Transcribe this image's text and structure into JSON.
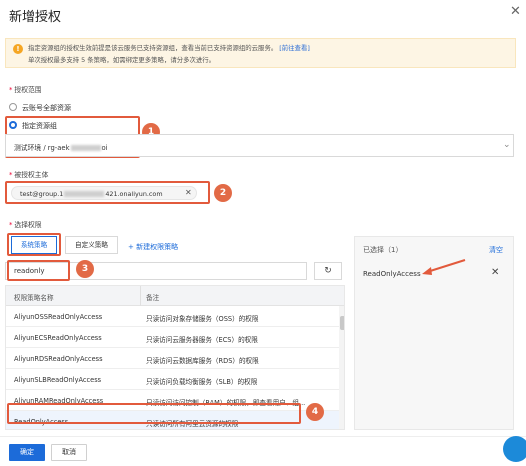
{
  "dialog": {
    "title": "新增授权",
    "close_icon": "close-icon"
  },
  "notice": {
    "icon": "info-icon",
    "line1": "指定资源组的授权生效前提是该云服务已支持资源组，查看当前已支持资源组的云服务。",
    "link": "[前往查看]",
    "line2": "单次授权最多支持 5 条策略，如需绑定更多策略，请分多次进行。"
  },
  "scope": {
    "label": "授权范围",
    "option_all": "云账号全部资源",
    "option_group": "指定资源组",
    "selected": "option_group",
    "select_value_prefix": "测试环境 / rg-aek",
    "select_value_suffix": "oi"
  },
  "principal": {
    "label": "被授权主体",
    "tag_prefix": "test@group.1",
    "tag_suffix": "421.onaliyun.com"
  },
  "permissions": {
    "label": "选择权限",
    "tab_system": "系统策略",
    "tab_custom": "自定义策略",
    "new_policy": "+ 新建权限策略",
    "search_value": "readonly",
    "refresh_icon": "refresh-icon",
    "col_name": "权限策略名称",
    "col_note": "备注",
    "rows": [
      {
        "name": "AliyunOSSReadOnlyAccess",
        "note": "只读访问对象存储服务（OSS）的权限"
      },
      {
        "name": "AliyunECSReadOnlyAccess",
        "note": "只读访问云服务器服务（ECS）的权限"
      },
      {
        "name": "AliyunRDSReadOnlyAccess",
        "note": "只读访问云数据库服务（RDS）的权限"
      },
      {
        "name": "AliyunSLBReadOnlyAccess",
        "note": "只读访问负载均衡服务（SLB）的权限"
      },
      {
        "name": "AliyunRAMReadOnlyAccess",
        "note": "只读访问访问控制（RAM）的权限，即查看用户、组..."
      },
      {
        "name": "ReadOnlyAccess",
        "note": "只读访问所有阿里云资源的权限"
      }
    ]
  },
  "selected_pane": {
    "header": "已选择（1）",
    "clear": "清空",
    "items": [
      "ReadOnlyAccess"
    ]
  },
  "callouts": [
    "1",
    "2",
    "3",
    "4"
  ],
  "footer": {
    "ok": "确定",
    "cancel": "取消"
  },
  "colors": {
    "primary": "#1c6bd9",
    "callout": "#e26a46",
    "notice_bg": "#fdf5e4"
  }
}
